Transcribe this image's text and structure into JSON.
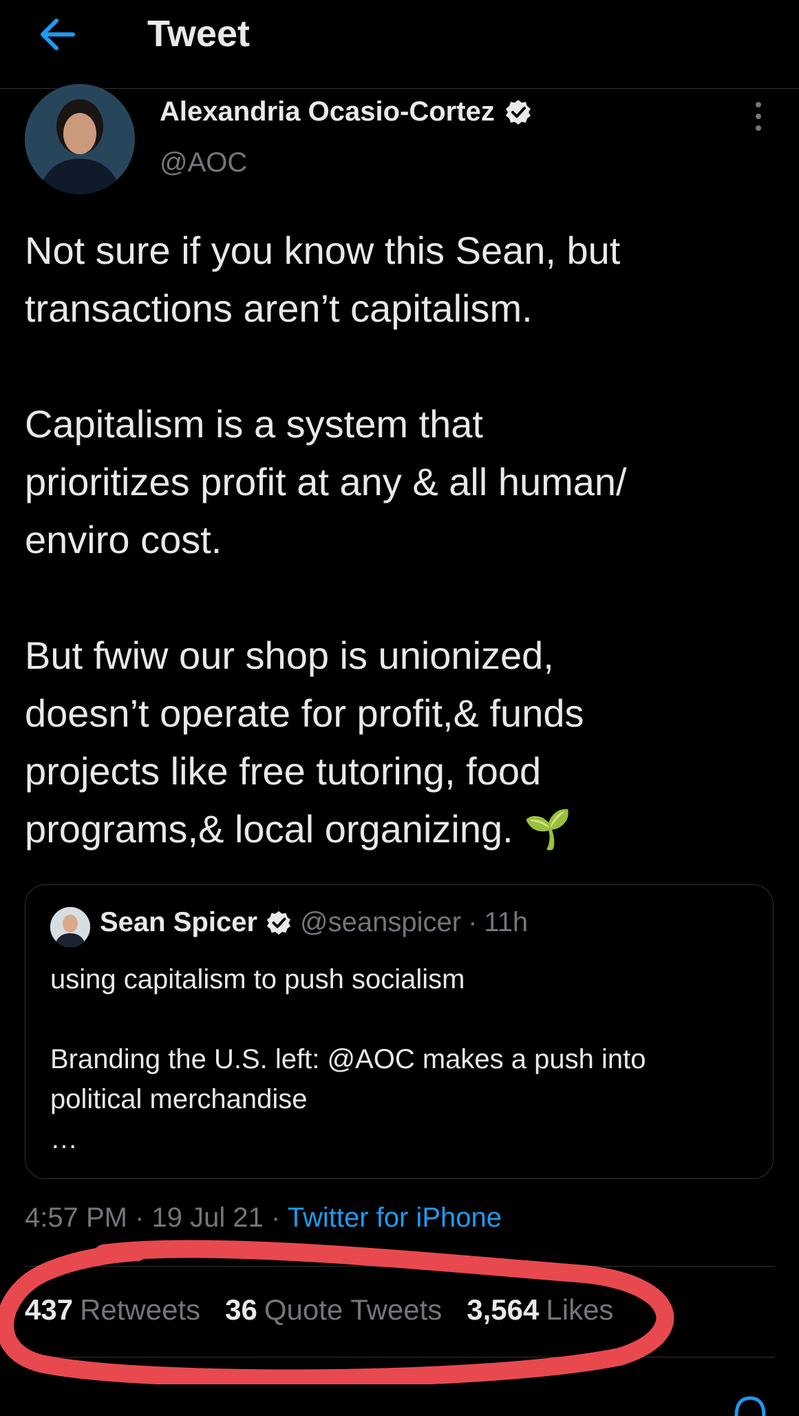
{
  "header": {
    "title": "Tweet",
    "back_icon": "arrow-left-icon"
  },
  "author": {
    "name": "Alexandria Ocasio-Cortez",
    "handle": "@AOC",
    "verified": true
  },
  "tweet": {
    "text": "Not sure if you know this Sean, but\ntransactions aren’t capitalism.\n\nCapitalism is a system that\nprioritizes profit at any & all human/\nenviro cost.\n\nBut fwiw our shop is unionized,\ndoesn’t operate for profit,& funds\nprojects like free tutoring, food\nprograms,& local organizing.",
    "emoji": "🌱"
  },
  "quote": {
    "name": "Sean Spicer",
    "handle": "@seanspicer",
    "separator": "·",
    "time": "11h",
    "body": "using capitalism to push socialism\n\nBranding the U.S. left: @AOC makes a push into\npolitical merchandise\n…"
  },
  "meta": {
    "time": "4:57 PM",
    "sep1": "·",
    "date": "19 Jul 21",
    "sep2": "·",
    "source": "Twitter for iPhone"
  },
  "stats": [
    {
      "num": "437",
      "label": "Retweets"
    },
    {
      "num": "36",
      "label": "Quote Tweets"
    },
    {
      "num": "3,564",
      "label": "Likes"
    }
  ],
  "colors": {
    "accent": "#1d9bf0",
    "annotation": "#e8494f",
    "background": "#000000"
  }
}
